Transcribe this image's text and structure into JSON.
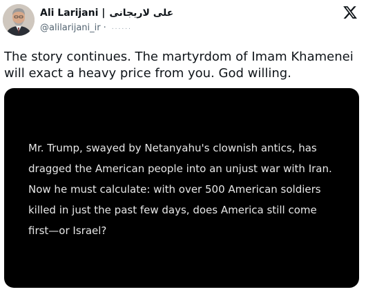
{
  "author": {
    "display_name": "Ali Larijani |",
    "display_name_rtl": "علی لاریجانی",
    "handle": "@alilarijani_ir",
    "separator": "·",
    "timestamp": "......"
  },
  "brand": {
    "logo_icon": "x-logo-icon",
    "logo_color": "#0f1419"
  },
  "tweet": {
    "text": "The story continues. The martyrdom of Imam Khamenei will exact a heavy price from you. God willing."
  },
  "media": {
    "background": "#000000",
    "text_color": "#e7e7e7",
    "quote_text": "Mr. Trump, swayed by Netanyahu's clownish antics, has dragged the American people into an unjust war with Iran. Now he must calculate: with over 500 American soldiers killed in just the past few days, does America still come first—or Israel?"
  }
}
